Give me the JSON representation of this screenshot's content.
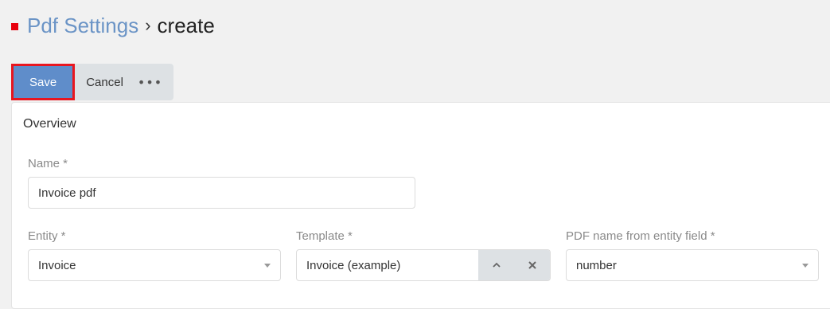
{
  "breadcrumb": {
    "parent": "Pdf Settings",
    "separator": "›",
    "current": "create"
  },
  "toolbar": {
    "save_label": "Save",
    "cancel_label": "Cancel",
    "more_label": "•••"
  },
  "panel": {
    "title": "Overview"
  },
  "fields": {
    "name": {
      "label": "Name *",
      "value": "Invoice pdf"
    },
    "entity": {
      "label": "Entity *",
      "value": "Invoice"
    },
    "template": {
      "label": "Template *",
      "value": "Invoice (example)"
    },
    "pdf_name": {
      "label": "PDF name from entity field *",
      "value": "number"
    }
  },
  "colors": {
    "accent": "#5f8dca",
    "marker": "#e8000d",
    "highlight_border": "#e8161f"
  },
  "icons": {
    "template_select": "chevron-up-icon",
    "template_clear": "close-icon",
    "dropdown": "caret-down-icon"
  }
}
